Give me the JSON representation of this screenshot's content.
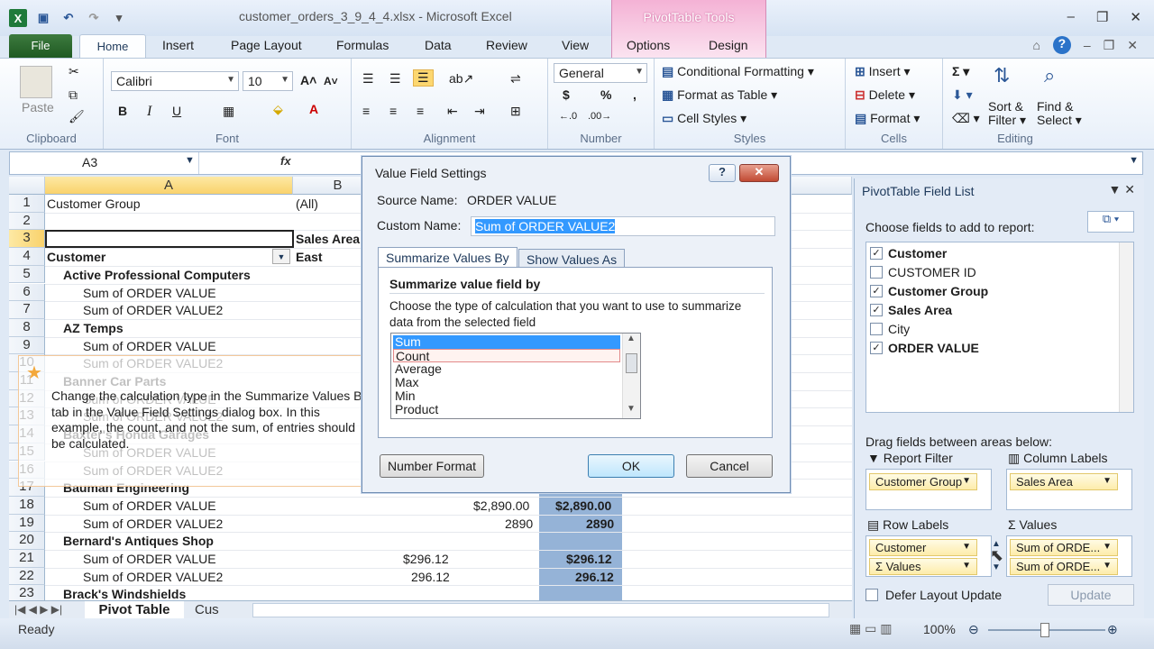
{
  "window": {
    "title": "customer_orders_3_9_4_4.xlsx - Microsoft Excel",
    "context_tab_group": "PivotTable Tools"
  },
  "tabs": {
    "file": "File",
    "home": "Home",
    "insert": "Insert",
    "page_layout": "Page Layout",
    "formulas": "Formulas",
    "data": "Data",
    "review": "Review",
    "view": "View",
    "options": "Options",
    "design": "Design"
  },
  "ribbon": {
    "clipboard": {
      "paste": "Paste",
      "label": "Clipboard"
    },
    "font": {
      "name": "Calibri",
      "size": "10",
      "label": "Font",
      "bold": "B",
      "italic": "I",
      "underline": "U"
    },
    "alignment": {
      "label": "Alignment"
    },
    "number": {
      "format": "General",
      "currency": "$",
      "percent": "%",
      "comma": ",",
      "label": "Number"
    },
    "styles": {
      "conditional": "Conditional Formatting",
      "format_table": "Format as Table",
      "cell_styles": "Cell Styles",
      "label": "Styles"
    },
    "cells": {
      "insert": "Insert",
      "delete": "Delete",
      "format": "Format",
      "label": "Cells"
    },
    "editing": {
      "sort": "Sort &",
      "filter": "Filter",
      "find": "Find &",
      "select": "Select",
      "label": "Editing"
    }
  },
  "formula_bar": {
    "name_box": "A3",
    "fx": "fx"
  },
  "grid": {
    "columns": [
      "A",
      "B"
    ],
    "rows": [
      {
        "n": "1",
        "a": "Customer Group",
        "b": "(All)"
      },
      {
        "n": "2",
        "a": "",
        "b": ""
      },
      {
        "n": "3",
        "a": "",
        "b": "Sales Area"
      },
      {
        "n": "4",
        "a": "Customer",
        "b": "East"
      },
      {
        "n": "5",
        "a": "Active Professional Computers",
        "b": ""
      },
      {
        "n": "6",
        "a": "Sum of ORDER VALUE",
        "b": ""
      },
      {
        "n": "7",
        "a": "Sum of ORDER VALUE2",
        "b": ""
      },
      {
        "n": "8",
        "a": "AZ Temps",
        "b": ""
      },
      {
        "n": "9",
        "a": "Sum of ORDER VALUE",
        "b": ""
      },
      {
        "n": "10",
        "a": "Sum of ORDER VALUE2",
        "b": ""
      },
      {
        "n": "11",
        "a": "Banner Car Parts",
        "b": ""
      },
      {
        "n": "12",
        "a": "Sum of ORDER VALUE",
        "b": ""
      },
      {
        "n": "13",
        "a": "Sum of ORDER VALUE2",
        "b": ""
      },
      {
        "n": "14",
        "a": "Baxter's Honda Garages",
        "b": ""
      },
      {
        "n": "15",
        "a": "Sum of ORDER VALUE",
        "b": ""
      },
      {
        "n": "16",
        "a": "Sum of ORDER VALUE2",
        "b": ""
      },
      {
        "n": "17",
        "a": "Bauman Engineering",
        "b": ""
      },
      {
        "n": "18",
        "a": "Sum of ORDER VALUE",
        "b": ""
      },
      {
        "n": "19",
        "a": "Sum of ORDER VALUE2",
        "b": ""
      },
      {
        "n": "20",
        "a": "Bernard's Antiques Shop",
        "b": ""
      },
      {
        "n": "21",
        "a": "Sum of ORDER VALUE",
        "b": ""
      },
      {
        "n": "22",
        "a": "Sum of ORDER VALUE2",
        "b": ""
      },
      {
        "n": "23",
        "a": "Brack's Windshields",
        "b": ""
      }
    ],
    "values": {
      "r18c": "$2,890.00",
      "r18d": "$2,890.00",
      "r19c": "2890",
      "r19d": "2890",
      "r21c": "$296.12",
      "r21d": "$296.12",
      "r22c": "296.12",
      "r22d": "296.12"
    },
    "sheet_tab_active": "Pivot Table",
    "sheet_tab_next": "Cus"
  },
  "status": {
    "ready": "Ready",
    "zoom": "100%"
  },
  "task_pane": {
    "title": "PivotTable Field List",
    "choose": "Choose fields to add to report:",
    "fields": [
      {
        "label": "Customer",
        "checked": true
      },
      {
        "label": "CUSTOMER ID",
        "checked": false
      },
      {
        "label": "Customer Group",
        "checked": true
      },
      {
        "label": "Sales Area",
        "checked": true
      },
      {
        "label": "City",
        "checked": false
      },
      {
        "label": "ORDER VALUE",
        "checked": true
      }
    ],
    "drag": "Drag fields between areas below:",
    "report_filter": "Report Filter",
    "column_labels": "Column Labels",
    "row_labels": "Row Labels",
    "values": "Values",
    "filter_item": "Customer Group",
    "column_item": "Sales Area",
    "row_items": [
      "Customer",
      "Values"
    ],
    "value_items": [
      "Sum of ORDE...",
      "Sum of ORDE..."
    ],
    "defer": "Defer Layout Update",
    "update": "Update"
  },
  "callout": {
    "text": "Change the calculation type in the Summarize Values By tab in the Value Field Settings dialog box. In this example, the count, and not the sum, of entries should be calculated."
  },
  "dialog": {
    "title": "Value Field Settings",
    "source_label": "Source Name:",
    "source_value": "ORDER VALUE",
    "custom_label": "Custom Name:",
    "custom_value": "Sum of ORDER VALUE2",
    "tab1": "Summarize Values By",
    "tab2": "Show Values As",
    "heading": "Summarize value field by",
    "desc": "Choose the type of calculation that you want to use to summarize data from the selected field",
    "calc_options": [
      "Sum",
      "Count",
      "Average",
      "Max",
      "Min",
      "Product"
    ],
    "number_format": "Number Format",
    "ok": "OK",
    "cancel": "Cancel"
  }
}
